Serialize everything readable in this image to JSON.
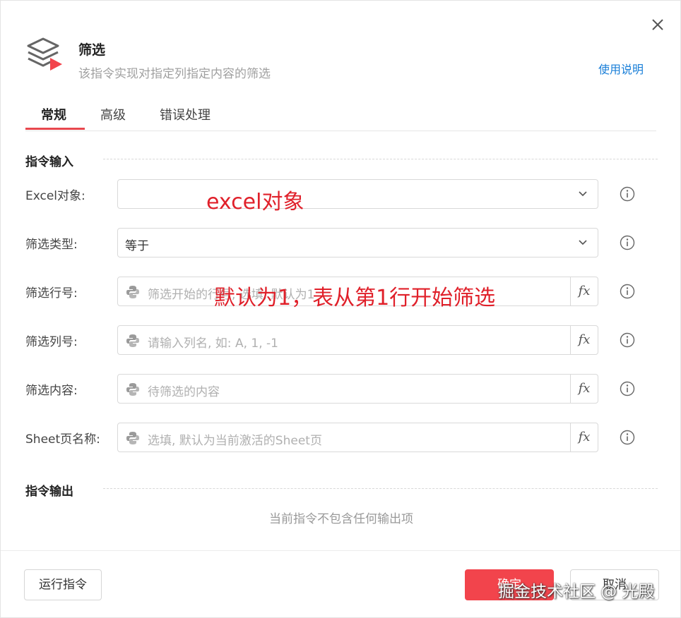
{
  "header": {
    "title": "筛选",
    "subtitle": "该指令实现对指定列指定内容的筛选",
    "help_link": "使用说明"
  },
  "tabs": [
    {
      "label": "常规",
      "active": true
    },
    {
      "label": "高级",
      "active": false
    },
    {
      "label": "错误处理",
      "active": false
    }
  ],
  "input_section": {
    "title": "指令输入",
    "fields": [
      {
        "label": "Excel对象:",
        "type": "select",
        "value": ""
      },
      {
        "label": "筛选类型:",
        "type": "select",
        "value": "等于"
      },
      {
        "label": "筛选行号:",
        "type": "expression",
        "placeholder": "筛选开始的行号, 选填, 默认为1"
      },
      {
        "label": "筛选列号:",
        "type": "expression",
        "placeholder": "请输入列名, 如: A, 1, -1"
      },
      {
        "label": "筛选内容:",
        "type": "expression",
        "placeholder": "待筛选的内容"
      },
      {
        "label": "Sheet页名称:",
        "type": "expression",
        "placeholder": "选填, 默认为当前激活的Sheet页"
      }
    ]
  },
  "output_section": {
    "title": "指令输出",
    "empty_text": "当前指令不包含任何输出项"
  },
  "annotations": {
    "excel_object": "excel对象",
    "row_default": "默认为1，表从第1行开始筛选"
  },
  "footer": {
    "run_button": "运行指令",
    "confirm_button": "确定",
    "cancel_button": "取消"
  },
  "watermark": "掘金技术社区 @ 光殿",
  "colors": {
    "accent": "#e8474e",
    "link": "#1a7fd8",
    "annotation": "#e0202a",
    "primary_button": "#f2444c"
  },
  "icons": {
    "header": "layers-play-icon",
    "close": "close-icon",
    "dropdown": "chevron-down-icon",
    "python": "python-icon",
    "fx": "fx-icon",
    "info": "info-icon"
  }
}
